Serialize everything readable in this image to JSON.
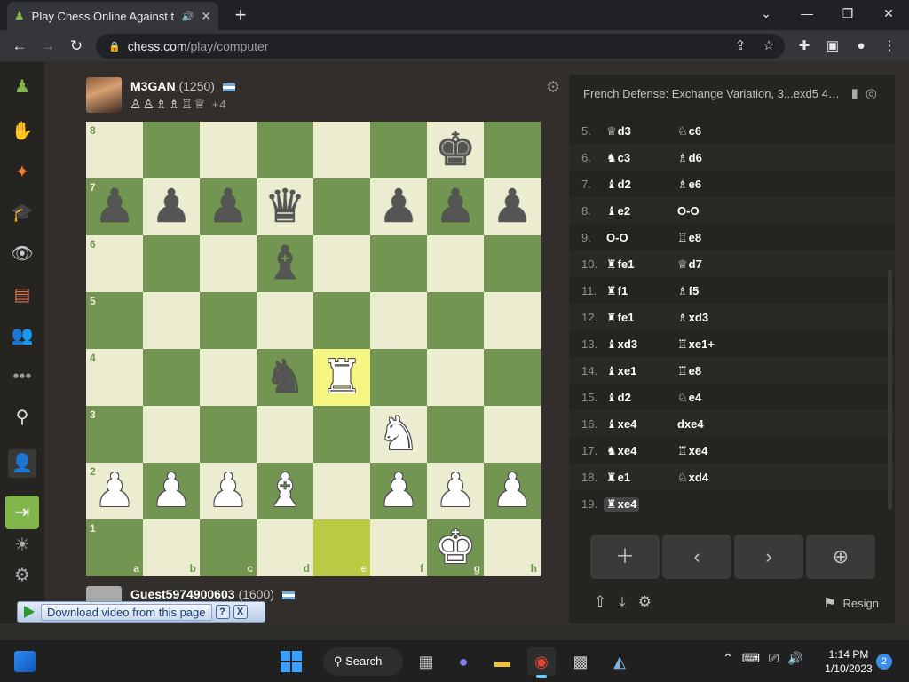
{
  "browser": {
    "tab_title": "Play Chess Online Against th",
    "url_host": "chess.com",
    "url_path": "/play/computer"
  },
  "sidebar": {
    "icons": [
      "chess-logo-icon",
      "play-icon",
      "puzzles-icon",
      "learn-icon",
      "watch-icon",
      "news-icon",
      "social-icon",
      "more-icon",
      "search-icon",
      "add-friend-icon",
      "login-icon",
      "theme-icon",
      "settings-icon"
    ]
  },
  "opponent": {
    "name": "M3GAN",
    "rating": "(1250)",
    "captured": "♙♙♗♗♖♕",
    "advantage": "+4"
  },
  "player": {
    "name": "Guest5974900603",
    "rating": "(1600)"
  },
  "board": {
    "ranks": [
      "8",
      "7",
      "6",
      "5",
      "4",
      "3",
      "2",
      "1"
    ],
    "files": [
      "a",
      "b",
      "c",
      "d",
      "e",
      "f",
      "g",
      "h"
    ],
    "position": [
      [
        "",
        "",
        "",
        "",
        "",
        "",
        "bk",
        ""
      ],
      [
        "bp",
        "bp",
        "bp",
        "bq",
        "",
        "bp",
        "bp",
        "bp"
      ],
      [
        "",
        "",
        "",
        "bb",
        "",
        "",
        "",
        ""
      ],
      [
        "",
        "",
        "",
        "",
        "",
        "",
        "",
        ""
      ],
      [
        "",
        "",
        "",
        "bn",
        "wr",
        "",
        "",
        ""
      ],
      [
        "",
        "",
        "",
        "",
        "",
        "wn",
        "",
        ""
      ],
      [
        "wp",
        "wp",
        "wp",
        "wb",
        "",
        "wp",
        "wp",
        "wp"
      ],
      [
        "",
        "",
        "",
        "",
        "",
        "",
        "wk",
        ""
      ]
    ],
    "last_move": [
      "e1",
      "e4"
    ]
  },
  "panel": {
    "opening": "French Defense: Exchange Variation, 3...exd5 4....",
    "moves": [
      {
        "no": "5.",
        "w_fig": "♕",
        "w": "d3",
        "b_fig": "♘",
        "b": "c6"
      },
      {
        "no": "6.",
        "w_fig": "♞",
        "w": "c3",
        "b_fig": "♗",
        "b": "d6"
      },
      {
        "no": "7.",
        "w_fig": "♝",
        "w": "d2",
        "b_fig": "♗",
        "b": "e6"
      },
      {
        "no": "8.",
        "w_fig": "♝",
        "w": "e2",
        "b_fig": "",
        "b": "O-O"
      },
      {
        "no": "9.",
        "w_fig": "",
        "w": "O-O",
        "b_fig": "♖",
        "b": "e8"
      },
      {
        "no": "10.",
        "w_fig": "♜",
        "w": "fe1",
        "b_fig": "♕",
        "b": "d7"
      },
      {
        "no": "11.",
        "w_fig": "♜",
        "w": "f1",
        "b_fig": "♗",
        "b": "f5"
      },
      {
        "no": "12.",
        "w_fig": "♜",
        "w": "fe1",
        "b_fig": "♗",
        "b": "xd3"
      },
      {
        "no": "13.",
        "w_fig": "♝",
        "w": "xd3",
        "b_fig": "♖",
        "b": "xe1+"
      },
      {
        "no": "14.",
        "w_fig": "♝",
        "w": "xe1",
        "b_fig": "♖",
        "b": "e8"
      },
      {
        "no": "15.",
        "w_fig": "♝",
        "w": "d2",
        "b_fig": "♘",
        "b": "e4"
      },
      {
        "no": "16.",
        "w_fig": "♝",
        "w": "xe4",
        "b_fig": "",
        "b": "dxe4"
      },
      {
        "no": "17.",
        "w_fig": "♞",
        "w": "xe4",
        "b_fig": "♖",
        "b": "xe4"
      },
      {
        "no": "18.",
        "w_fig": "♜",
        "w": "e1",
        "b_fig": "♘",
        "b": "xd4"
      },
      {
        "no": "19.",
        "w_fig": "♜",
        "w": "xe4",
        "b_fig": "",
        "b": ""
      }
    ],
    "resign_label": "Resign"
  },
  "download_bar": {
    "label": "Download video from this page",
    "help": "?",
    "close": "X"
  },
  "taskbar": {
    "search_label": "Search",
    "time": "1:14 PM",
    "date": "1/10/2023",
    "notifications": "2"
  }
}
